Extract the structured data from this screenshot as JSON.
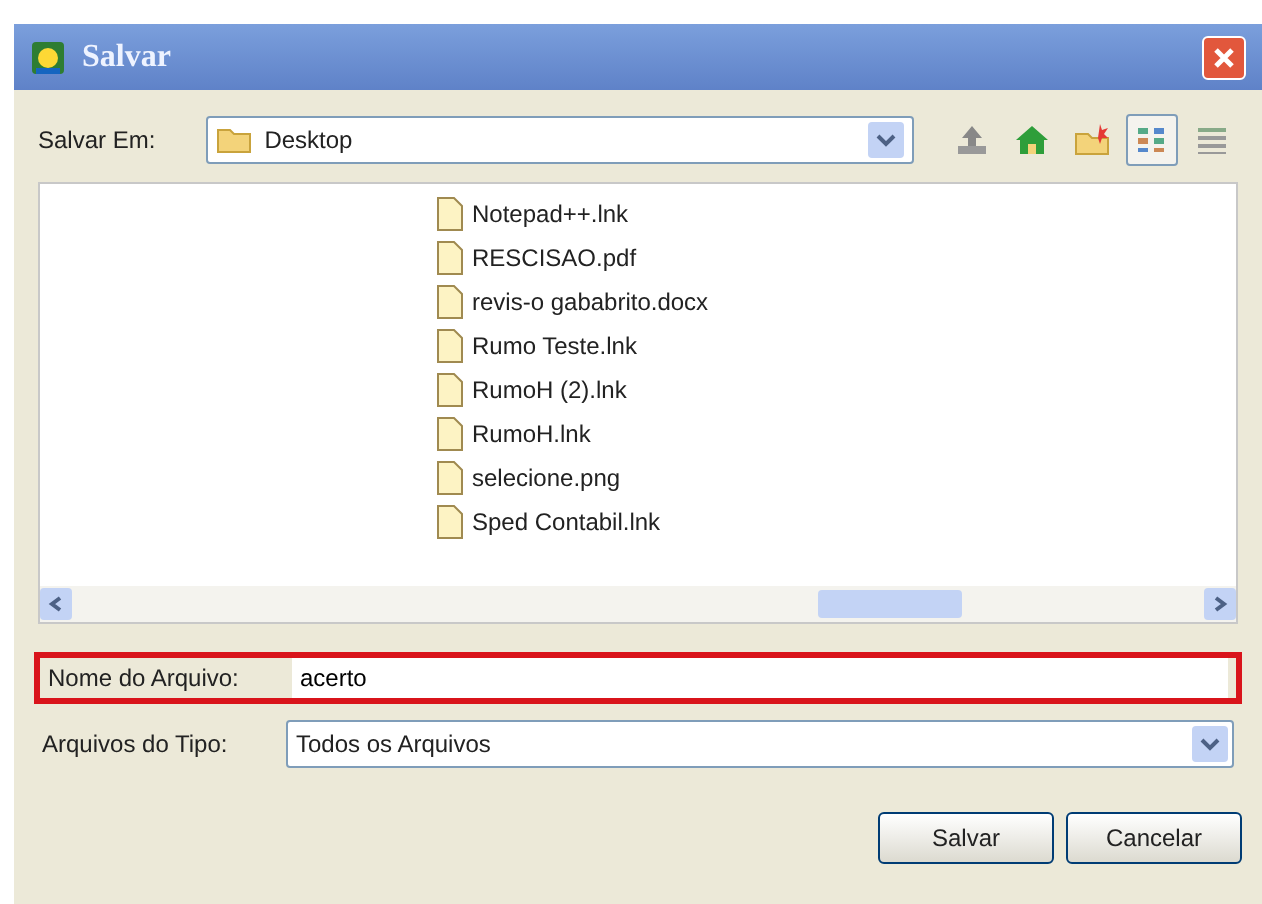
{
  "window": {
    "title": "Salvar"
  },
  "location": {
    "label": "Salvar Em:",
    "value": "Desktop"
  },
  "toolbar": [
    {
      "kind": "up",
      "selected": false
    },
    {
      "kind": "home",
      "selected": false
    },
    {
      "kind": "new-folder",
      "selected": false
    },
    {
      "kind": "list",
      "selected": true
    },
    {
      "kind": "details",
      "selected": false
    }
  ],
  "files": [
    {
      "name": "Notepad++.lnk"
    },
    {
      "name": "RESCISAO.pdf"
    },
    {
      "name": "revis-o gababrito.docx"
    },
    {
      "name": "Rumo Teste.lnk"
    },
    {
      "name": "RumoH (2).lnk"
    },
    {
      "name": "RumoH.lnk"
    },
    {
      "name": "selecione.png"
    },
    {
      "name": "Sped Contabil.lnk"
    }
  ],
  "file_name": {
    "label": "Nome do Arquivo:",
    "value": "acerto",
    "highlighted": true
  },
  "file_type": {
    "label": "Arquivos do Tipo:",
    "value": "Todos os Arquivos"
  },
  "buttons": [
    {
      "label": "Salvar"
    },
    {
      "label": "Cancelar"
    }
  ]
}
